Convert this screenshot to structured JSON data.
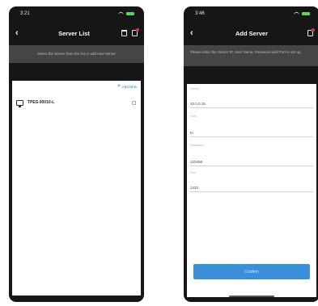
{
  "server_list": {
    "status_time": "3:21",
    "title": "Server List",
    "banner_text": "Select the Server from the list or add new Server",
    "add_label": "Add New",
    "server_name": "TPES-00010-L"
  },
  "add_server": {
    "status_time": "3:46",
    "title": "Add Server",
    "banner_text": "Please enter the Server IP, User Name, Password and Port to set up",
    "fields": [
      {
        "label": "Server",
        "value": "10.0.0.15"
      },
      {
        "label": "User",
        "value": "tn"
      },
      {
        "label": "Password",
        "value": "123456"
      },
      {
        "label": "Port",
        "value": "1433"
      }
    ],
    "confirm_label": "Confirm"
  },
  "colors": {
    "accent": "#3a8fd9",
    "link": "#2e7ee0",
    "navbar": "#161616",
    "banner": "#454545"
  }
}
